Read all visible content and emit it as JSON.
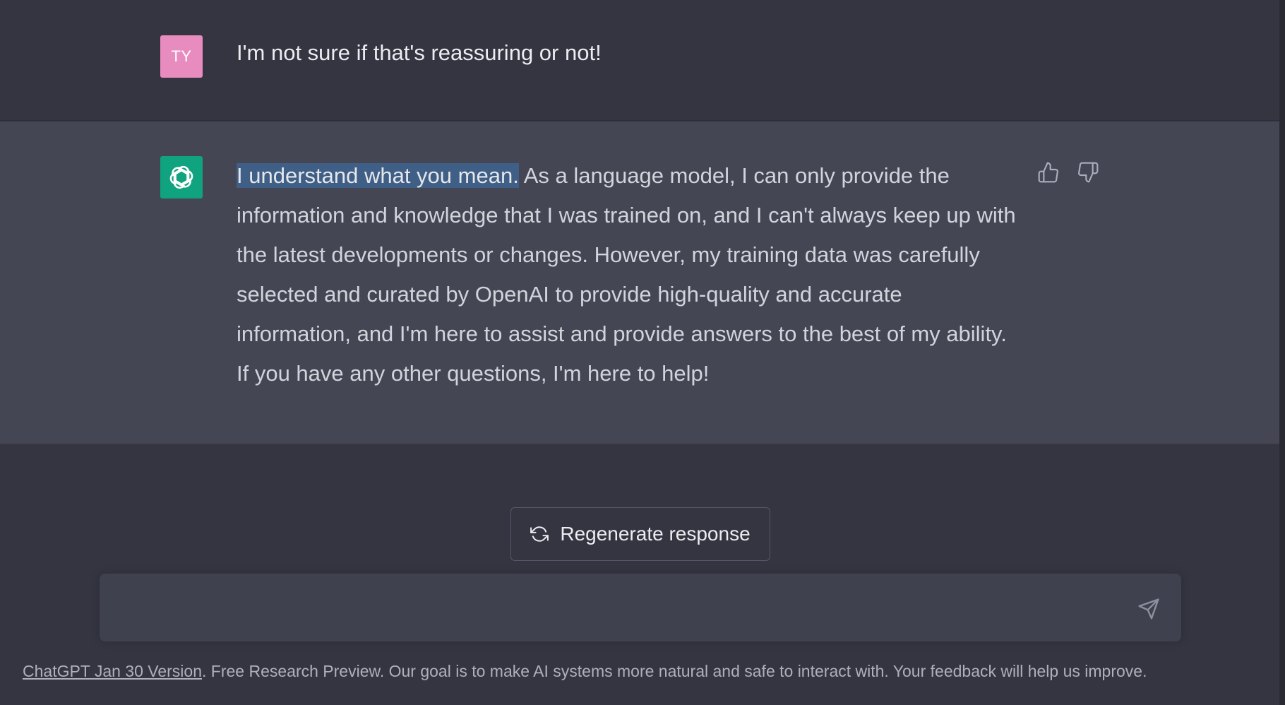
{
  "user_message": {
    "avatar_initials": "TY",
    "avatar_color": "#e88cc0",
    "text": "I'm not sure if that's reassuring or not!"
  },
  "assistant_message": {
    "avatar_icon": "openai-logo-icon",
    "avatar_color": "#10a37f",
    "highlighted_text": "I understand what you mean.",
    "text": " As a language model, I can only provide the information and knowledge that I was trained on, and I can't always keep up with the latest developments or changes. However, my training data was carefully selected and curated by OpenAI to provide high-quality and accurate information, and I'm here to assist and provide answers to the best of my ability. If you have any other questions, I'm here to help!",
    "feedback": {
      "thumbs_up_icon": "thumbs-up-icon",
      "thumbs_down_icon": "thumbs-down-icon"
    }
  },
  "regenerate_button": {
    "label": "Regenerate response",
    "icon": "refresh-icon"
  },
  "input": {
    "value": "",
    "send_icon": "send-icon"
  },
  "footer": {
    "link_text": "ChatGPT Jan 30 Version",
    "text": ". Free Research Preview. Our goal is to make AI systems more natural and safe to interact with. Your feedback will help us improve."
  },
  "colors": {
    "background": "#343541",
    "assistant_background": "#444654",
    "input_background": "#40414f",
    "selection_highlight": "#3f5f86"
  }
}
